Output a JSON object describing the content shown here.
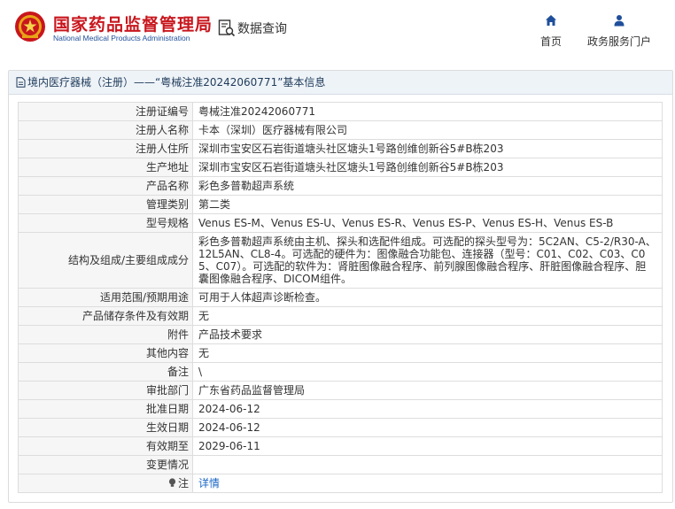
{
  "header": {
    "logo_cn": "国家药品监督管理局",
    "logo_en": "National Medical Products Administration",
    "data_query": "数据查询",
    "nav": [
      {
        "label": "首页",
        "icon": "home-icon"
      },
      {
        "label": "政务服务门户",
        "icon": "user-icon"
      }
    ]
  },
  "panel": {
    "title": "境内医疗器械（注册）——“粤械注准20242060771”基本信息"
  },
  "rows": [
    {
      "key": "注册证编号",
      "value": "粤械注准20242060771"
    },
    {
      "key": "注册人名称",
      "value": "卡本（深圳）医疗器械有限公司"
    },
    {
      "key": "注册人住所",
      "value": "深圳市宝安区石岩街道塘头社区塘头1号路创维创新谷5#B栋203"
    },
    {
      "key": "生产地址",
      "value": "深圳市宝安区石岩街道塘头社区塘头1号路创维创新谷5#B栋203"
    },
    {
      "key": "产品名称",
      "value": "彩色多普勒超声系统"
    },
    {
      "key": "管理类别",
      "value": "第二类"
    },
    {
      "key": "型号规格",
      "value": "Venus ES-M、Venus ES-U、Venus ES-R、Venus ES-P、Venus ES-H、Venus ES-B"
    },
    {
      "key": "结构及组成/主要组成成分",
      "value": "彩色多普勒超声系统由主机、探头和选配件组成。可选配的探头型号为：5C2AN、C5-2/R30-A、12L5AN、CL8-4。可选配的硬件为：图像融合功能包、连接器（型号：C01、C02、C03、C05、C07）。可选配的软件为：肾脏图像融合程序、前列腺图像融合程序、肝脏图像融合程序、胆囊图像融合程序、DICOM组件。"
    },
    {
      "key": "适用范围/预期用途",
      "value": "可用于人体超声诊断检查。"
    },
    {
      "key": "产品储存条件及有效期",
      "value": "无"
    },
    {
      "key": "附件",
      "value": "产品技术要求"
    },
    {
      "key": "其他内容",
      "value": "无"
    },
    {
      "key": "备注",
      "value": "\\"
    },
    {
      "key": "审批部门",
      "value": "广东省药品监督管理局"
    },
    {
      "key": "批准日期",
      "value": "2024-06-12"
    },
    {
      "key": "生效日期",
      "value": "2024-06-12"
    },
    {
      "key": "有效期至",
      "value": "2029-06-11"
    },
    {
      "key": "变更情况",
      "value": ""
    },
    {
      "key": "注",
      "value": "详情"
    }
  ],
  "colors": {
    "brand_red": "#c8161d",
    "brand_blue": "#1f4f9a",
    "link": "#1a66c6"
  }
}
